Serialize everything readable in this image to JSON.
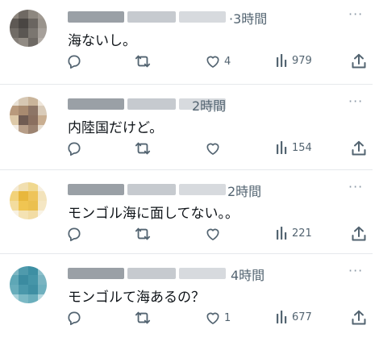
{
  "tweets": [
    {
      "time": "·3時間",
      "text": "海ないし。",
      "likes": "4",
      "views": "979",
      "avatar_colors": [
        "#8c857d",
        "#6f6963",
        "#8d877f",
        "#a19a92",
        "#5e5954",
        "#4a4643",
        "#6a6560",
        "#9a948d",
        "#716c66",
        "#5b5753",
        "#7b7670",
        "#a6a09a",
        "#86807a",
        "#918b84",
        "#6e6964",
        "#b2aca6"
      ]
    },
    {
      "time": "2時間",
      "text": "内陸国だけど。",
      "likes": "",
      "views": "154",
      "avatar_colors": [
        "#e8e0d3",
        "#d6c7b3",
        "#c9b49a",
        "#efe6da",
        "#b99a7c",
        "#a88a70",
        "#8d7566",
        "#d9cbb9",
        "#ddc9a8",
        "#6f5b52",
        "#8a6f5f",
        "#c9ae91",
        "#f2ece3",
        "#b79e88",
        "#9c8371",
        "#e7ddd0"
      ]
    },
    {
      "time": "2時間",
      "text": "モンゴル海に面してない。。",
      "likes": "",
      "views": "221",
      "avatar_colors": [
        "#f4ead4",
        "#f1dfb0",
        "#f0d88f",
        "#f6efdf",
        "#f2d27a",
        "#e8b73c",
        "#eec45a",
        "#f3e3bb",
        "#f3dc9e",
        "#f0c552",
        "#ebc04f",
        "#f5e7c4",
        "#f8f1e2",
        "#f4e2b3",
        "#f2dca4",
        "#f9f3e6"
      ]
    },
    {
      "time": "4時間",
      "text": "モンゴルて海あるの？",
      "likes": "1",
      "views": "677",
      "avatar_colors": [
        "#7fb7c3",
        "#4f9aac",
        "#3d8fa3",
        "#8cc0cb",
        "#5ea7b6",
        "#3b8ba0",
        "#4595a8",
        "#7ab4c1",
        "#68adbb",
        "#4a98ab",
        "#3f8fa3",
        "#6fb0be",
        "#a9d2da",
        "#7bb9c5",
        "#6aaebc",
        "#b5d8df"
      ]
    }
  ],
  "icons": {
    "reply": "speech-bubble-icon",
    "retweet": "retweet-arrows-icon",
    "like": "heart-icon",
    "views": "bar-chart-icon",
    "share": "share-upload-icon",
    "more": "ellipsis-icon"
  },
  "more_glyph": "···"
}
